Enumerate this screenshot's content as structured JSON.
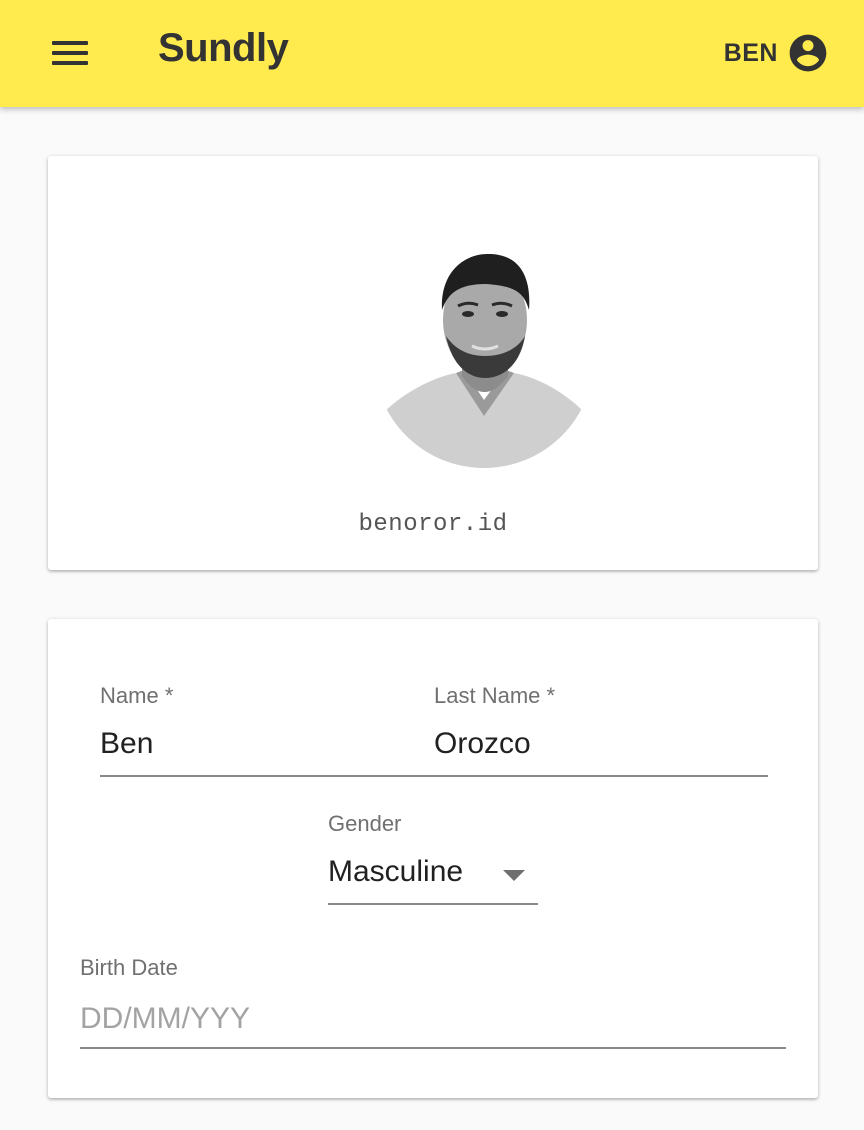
{
  "appbar": {
    "title": "Sundly",
    "user_name": "BEN",
    "menu_icon": "menu-icon",
    "account_icon": "account-circle-icon",
    "color": "#ffeb4d"
  },
  "profile": {
    "handle": "benoror.id",
    "avatar_alt": "profile photo"
  },
  "form": {
    "name": {
      "label": "Name",
      "required_mark": "*",
      "value": "Ben"
    },
    "last_name": {
      "label": "Last Name",
      "required_mark": "*",
      "value": "Orozco"
    },
    "gender": {
      "label": "Gender",
      "value": "Masculine"
    },
    "birth_date": {
      "label": "Birth Date",
      "placeholder": "DD/MM/YYY",
      "value": ""
    }
  }
}
